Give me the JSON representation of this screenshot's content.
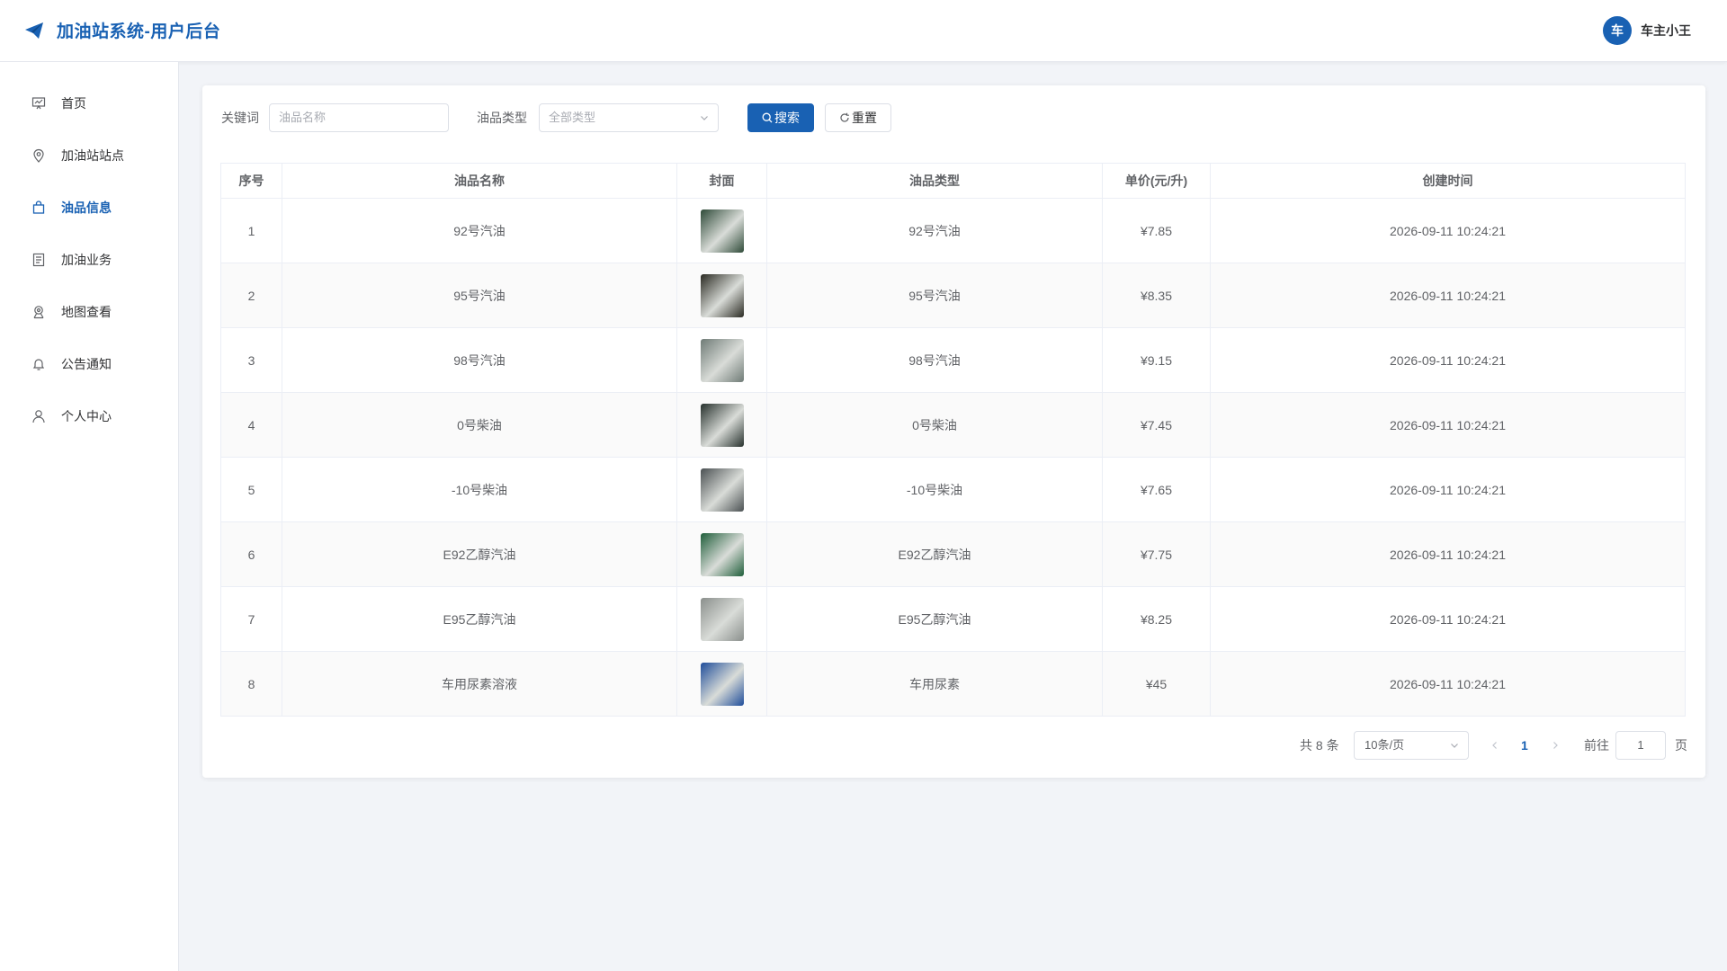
{
  "header": {
    "title": "加油站系统-用户后台",
    "user_avatar_text": "车",
    "user_name": "车主小王"
  },
  "sidebar": {
    "items": [
      {
        "label": "首页",
        "icon": "monitor-chart-icon",
        "active": false
      },
      {
        "label": "加油站站点",
        "icon": "location-pin-icon",
        "active": false
      },
      {
        "label": "油品信息",
        "icon": "shopping-bag-icon",
        "active": true
      },
      {
        "label": "加油业务",
        "icon": "document-icon",
        "active": false
      },
      {
        "label": "地图查看",
        "icon": "map-location-icon",
        "active": false
      },
      {
        "label": "公告通知",
        "icon": "bell-icon",
        "active": false
      },
      {
        "label": "个人中心",
        "icon": "user-icon",
        "active": false
      }
    ]
  },
  "filters": {
    "keyword_label": "关键词",
    "keyword_placeholder": "油品名称",
    "type_label": "油品类型",
    "type_placeholder": "全部类型",
    "search_button": "搜索",
    "reset_button": "重置"
  },
  "table": {
    "columns": [
      "序号",
      "油品名称",
      "封面",
      "油品类型",
      "单价(元/升)",
      "创建时间"
    ],
    "rows": [
      {
        "index": "1",
        "name": "92号汽油",
        "type": "92号汽油",
        "price": "¥7.85",
        "created": "2026-09-11 10:24:21",
        "thumb_color": "#2e4a38"
      },
      {
        "index": "2",
        "name": "95号汽油",
        "type": "95号汽油",
        "price": "¥8.35",
        "created": "2026-09-11 10:24:21",
        "thumb_color": "#2a2a22"
      },
      {
        "index": "3",
        "name": "98号汽油",
        "type": "98号汽油",
        "price": "¥9.15",
        "created": "2026-09-11 10:24:21",
        "thumb_color": "#6f7b76"
      },
      {
        "index": "4",
        "name": "0号柴油",
        "type": "0号柴油",
        "price": "¥7.45",
        "created": "2026-09-11 10:24:21",
        "thumb_color": "#26302c"
      },
      {
        "index": "5",
        "name": "-10号柴油",
        "type": "-10号柴油",
        "price": "¥7.65",
        "created": "2026-09-11 10:24:21",
        "thumb_color": "#4a5052"
      },
      {
        "index": "6",
        "name": "E92乙醇汽油",
        "type": "E92乙醇汽油",
        "price": "¥7.75",
        "created": "2026-09-11 10:24:21",
        "thumb_color": "#1f5e3a"
      },
      {
        "index": "7",
        "name": "E95乙醇汽油",
        "type": "E95乙醇汽油",
        "price": "¥8.25",
        "created": "2026-09-11 10:24:21",
        "thumb_color": "#8a8f8c"
      },
      {
        "index": "8",
        "name": "车用尿素溶液",
        "type": "车用尿素",
        "price": "¥45",
        "created": "2026-09-11 10:24:21",
        "thumb_color": "#1f4d9a"
      }
    ]
  },
  "pagination": {
    "total_text": "共 8 条",
    "page_size": "10条/页",
    "current_page": "1",
    "goto_label": "前往",
    "goto_value": "1",
    "page_unit": "页"
  },
  "colors": {
    "primary": "#1961b3",
    "background": "#f2f4f8"
  }
}
